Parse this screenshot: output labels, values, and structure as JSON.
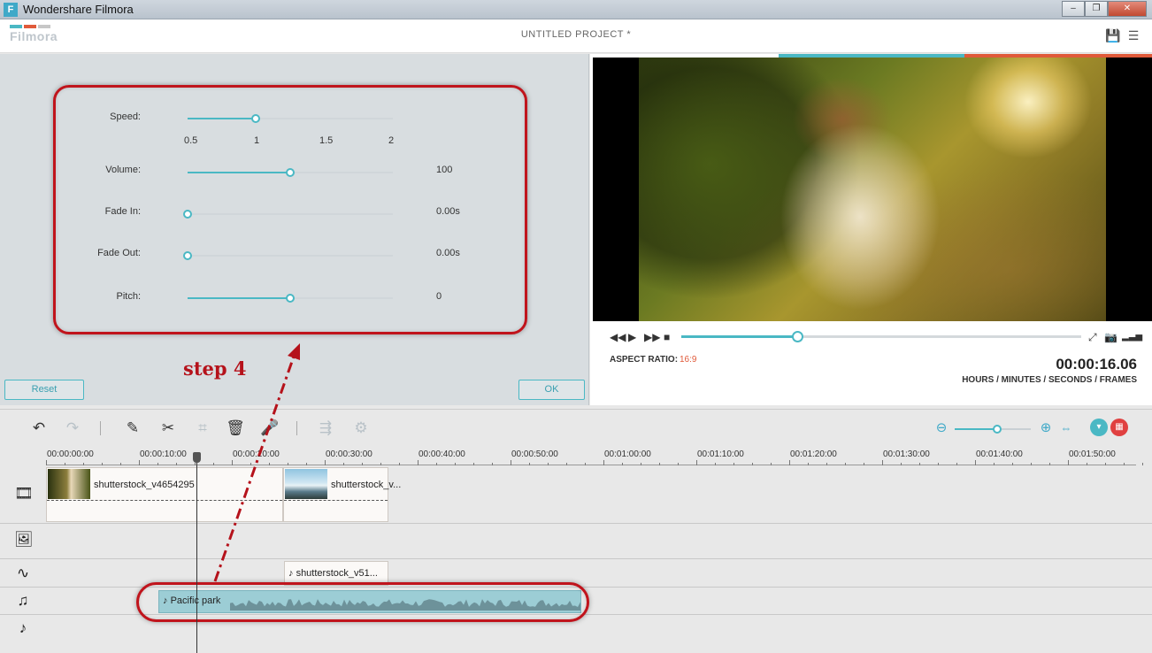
{
  "window": {
    "title": "Wondershare Filmora",
    "app_icon": "F",
    "buttons": [
      "–",
      "❐",
      "✕"
    ]
  },
  "header": {
    "logo_text": "Filmora",
    "logo_colors": [
      "#4ab8c4",
      "#e05a3a",
      "#c7c7c7"
    ],
    "project_title": "UNTITLED PROJECT *",
    "icons": [
      "save-icon",
      "menu-icon"
    ]
  },
  "audio_panel": {
    "params": [
      {
        "label": "Speed:",
        "value": "",
        "level": 0.333
      },
      {
        "label": "Volume:",
        "value": "100",
        "level": 0.5
      },
      {
        "label": "Fade In:",
        "value": "0.00s",
        "level": 0.0
      },
      {
        "label": "Fade Out:",
        "value": "0.00s",
        "level": 0.0
      },
      {
        "label": "Pitch:",
        "value": "0",
        "level": 0.5
      }
    ],
    "speed_ticks": [
      "0.5",
      "1",
      "1.5",
      "2"
    ],
    "reset_label": "Reset",
    "ok_label": "OK",
    "annotation": "step 4",
    "annotation_color": "#c0141c"
  },
  "preview": {
    "strip_colors": [
      "#4ab8c4",
      "#e05a3a"
    ],
    "controls": [
      "rewind-icon",
      "play-icon",
      "fast-forward-icon",
      "stop-icon"
    ],
    "progress": 0.29,
    "aspect_label": "ASPECT RATIO:",
    "aspect_value": "16:9",
    "timecode": "00:00:16.06",
    "timecode_units": "HOURS / MINUTES / SECONDS / FRAMES"
  },
  "toolbar": {
    "tools": [
      "undo-icon",
      "redo-icon",
      "edit-icon",
      "split-icon",
      "crop-icon",
      "delete-icon",
      "voice-icon",
      "export-icon",
      "settings-icon"
    ],
    "zoom_level": 0.56,
    "accent": "#4ab8c4",
    "danger": "#e04040"
  },
  "timeline": {
    "ruler": [
      "00:00:00:00",
      "00:00:10:00",
      "00:00:20:00",
      "00:00:30:00",
      "00:00:40:00",
      "00:00:50:00",
      "00:01:00:00",
      "00:01:10:00",
      "00:01:20:00",
      "00:01:30:00",
      "00:01:40:00",
      "00:01:50:00"
    ],
    "video_clips": [
      "shutterstock_v4654295",
      "shutterstock_v..."
    ],
    "audio_clip_top": "shutterstock_v51...",
    "audio_clip_main": "Pacific park",
    "track_icons": [
      "film-icon",
      "image-icon",
      "waveform-icon",
      "music-file-icon",
      "music-note-icon"
    ]
  }
}
